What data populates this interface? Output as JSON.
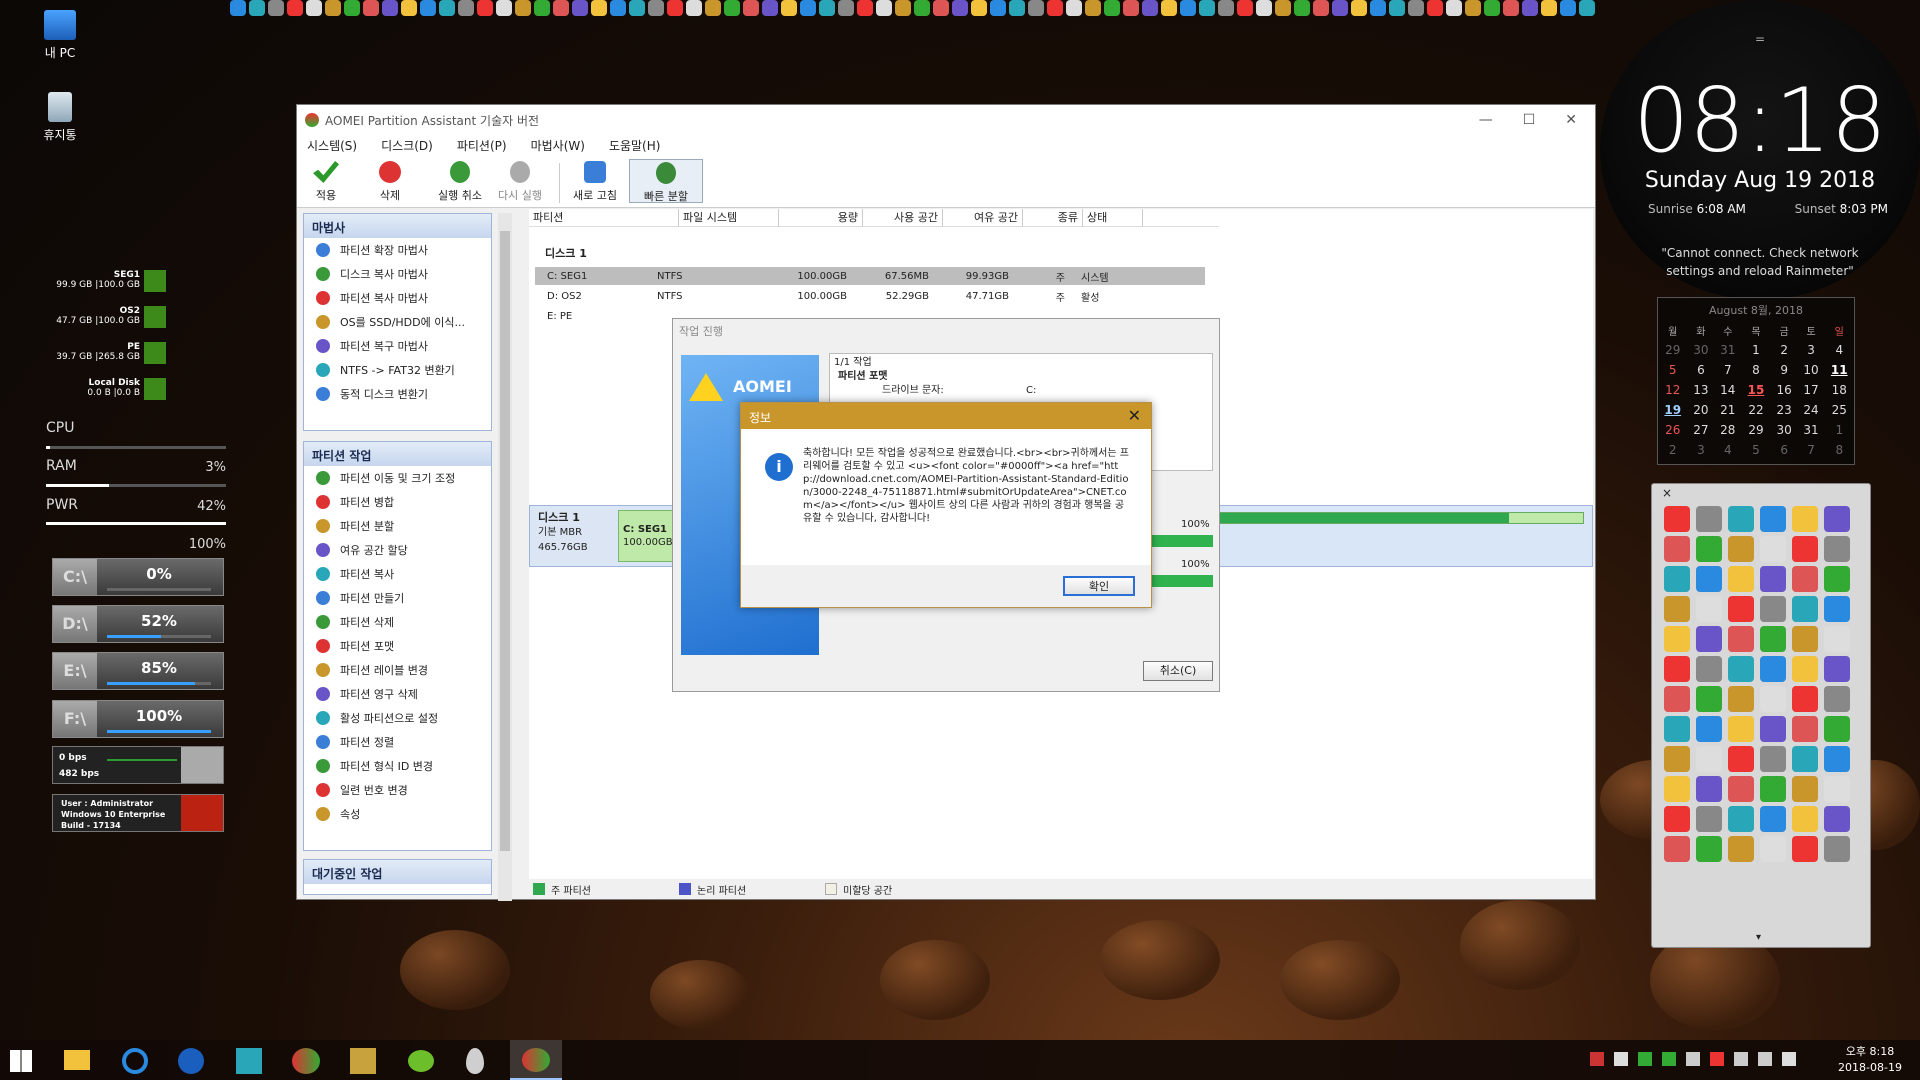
{
  "desktop": {
    "icons": [
      {
        "label": "내 PC"
      },
      {
        "label": "휴지통"
      }
    ],
    "drives_info": [
      {
        "name": "SEG1",
        "line": "99.9 GB |100.0 GB"
      },
      {
        "name": "OS2",
        "line": "47.7 GB |100.0 GB"
      },
      {
        "name": "PE",
        "line": "39.7 GB |265.8 GB"
      },
      {
        "name": "Local Disk",
        "line": "0.0 B |0.0 B"
      }
    ],
    "cpu_label": "CPU",
    "cpu_value": "",
    "ram_label": "RAM",
    "ram_value": "3%",
    "pwr_label": "PWR",
    "pwr_value": "42%",
    "pwr_total": "100%",
    "drive_bars": [
      {
        "letter": "C:\\",
        "pct": "0%",
        "fill": 0
      },
      {
        "letter": "D:\\",
        "pct": "52%",
        "fill": 0.52
      },
      {
        "letter": "E:\\",
        "pct": "85%",
        "fill": 0.85
      },
      {
        "letter": "F:\\",
        "pct": "100%",
        "fill": 1.0
      }
    ],
    "net_up": "0 bps",
    "net_down": "482 bps",
    "user_line1": "User : Administrator",
    "user_line2": "Windows 10 Enterprise",
    "user_line3": "Build - 17134"
  },
  "clock": {
    "menu": "=",
    "time": "08:18",
    "date": "Sunday Aug 19 2018",
    "sunrise_label": "Sunrise",
    "sunrise": "6:08 AM",
    "sunset_label": "Sunset",
    "sunset": "8:03 PM",
    "weather_msg": "\"Cannot connect. Check network settings and reload Rainmeter\""
  },
  "calendar": {
    "title": "August 8월, 2018",
    "weekdays": [
      "월",
      "화",
      "수",
      "목",
      "금",
      "토",
      "일"
    ],
    "rows": [
      [
        "29",
        "30",
        "31",
        "1",
        "2",
        "3",
        "4"
      ],
      [
        "5",
        "6",
        "7",
        "8",
        "9",
        "10",
        "11"
      ],
      [
        "12",
        "13",
        "14",
        "15",
        "16",
        "17",
        "18"
      ],
      [
        "19",
        "20",
        "21",
        "22",
        "23",
        "24",
        "25"
      ],
      [
        "26",
        "27",
        "28",
        "29",
        "30",
        "31",
        "1"
      ],
      [
        "2",
        "3",
        "4",
        "5",
        "6",
        "7",
        "8"
      ]
    ]
  },
  "window": {
    "title": "AOMEI Partition Assistant 기술자 버전",
    "menus": [
      "시스템(S)",
      "디스크(D)",
      "파티션(P)",
      "마법사(W)",
      "도움말(H)"
    ],
    "toolbar": [
      "적용",
      "삭제",
      "실행 취소",
      "다시 실행",
      "새로 고침",
      "빠른 분할"
    ],
    "wizard_panel": {
      "title": "마법사",
      "items": [
        "파티션 확장 마법사",
        "디스크 복사 마법사",
        "파티션 복사 마법사",
        "OS를 SSD/HDD에 이식...",
        "파티션 복구 마법사",
        "NTFS -> FAT32 변환기",
        "동적 디스크 변환기"
      ]
    },
    "partition_panel": {
      "title": "파티션 작업",
      "items": [
        "파티션 이동 및 크기 조정",
        "파티션 병합",
        "파티션 분할",
        "여유 공간 할당",
        "파티션 복사",
        "파티션 만들기",
        "파티션 삭제",
        "파티션 포맷",
        "파티션 레이블 변경",
        "파티션 영구 삭제",
        "활성 파티션으로 설정",
        "파티션 정렬",
        "파티션 형식 ID 변경",
        "일련 번호 변경",
        "속성"
      ]
    },
    "pending_panel": {
      "title": "대기중인 작업"
    },
    "columns": [
      "파티션",
      "파일 시스템",
      "용량",
      "사용 공간",
      "여유 공간",
      "종류",
      "상태"
    ],
    "disk_label": "디스크 1",
    "rows": [
      [
        "C: SEG1",
        "NTFS",
        "100.00GB",
        "67.56MB",
        "99.93GB",
        "주",
        "시스템"
      ],
      [
        "D: OS2",
        "NTFS",
        "100.00GB",
        "52.29GB",
        "47.71GB",
        "주",
        "활성"
      ],
      [
        "E: PE",
        "",
        "",
        "",
        "",
        "",
        ""
      ]
    ],
    "disk_map": {
      "name": "디스크 1",
      "type": "기본 MBR",
      "size": "465.76GB",
      "part_name": "C: SEG1",
      "part_size": "100.00GB"
    },
    "legend": [
      "주 파티션",
      "논리 파티션",
      "미할당 공간"
    ]
  },
  "progress_dialog": {
    "title": "작업 진행",
    "brand": "AOMEI",
    "op_count": "1/1 작업",
    "op_name": "파티션 포맷",
    "drive_label": "드라이브 문자:",
    "drive_value": "C:",
    "pct1": "100%",
    "pct2": "100%",
    "cancel": "취소(C)"
  },
  "info_dialog": {
    "title": "정보",
    "message": "축하합니다! 모든 작업을 성공적으로 완료했습니다.<br><br>귀하께서는 프리웨어를 검토할 수 있고 <u><font color=\"#0000ff\"><a href=\"http://download.cnet.com/AOMEI-Partition-Assistant-Standard-Edition/3000-2248_4-75118871.html#submitOrUpdateArea\">CNET.com</a></font></u> 웹사이트 상의 다른 사람과 귀하의 경험과 행복을 공유할 수 있습니다, 감사합니다!",
    "ok": "확인"
  },
  "taskbar": {
    "time": "오후 8:18",
    "date": "2018-08-19"
  }
}
